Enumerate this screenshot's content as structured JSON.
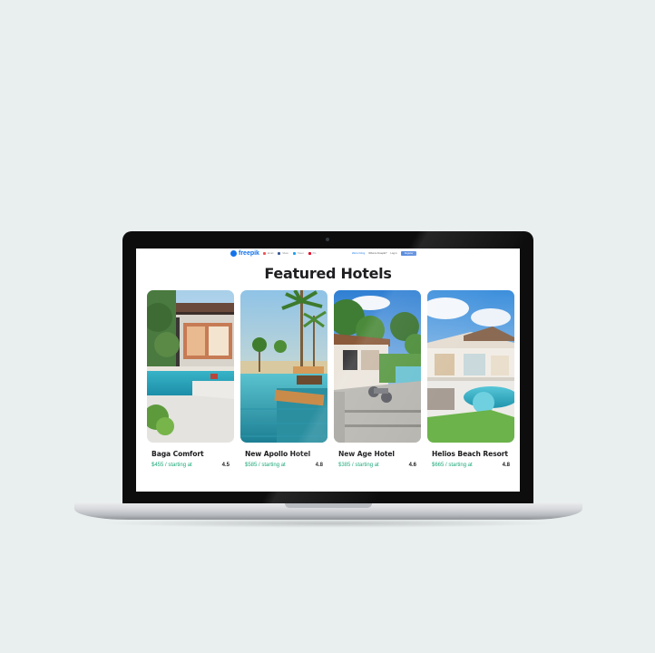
{
  "header": {
    "logo_text": "freepik",
    "social": [
      {
        "label": "Email",
        "color": "#e55",
        "icon": "email-icon"
      },
      {
        "label": "Share",
        "color": "#3b5998",
        "icon": "facebook-icon"
      },
      {
        "label": "Tweet",
        "color": "#1da1f2",
        "icon": "twitter-icon"
      },
      {
        "label": "Pin",
        "color": "#e60023",
        "icon": "pinterest-icon"
      }
    ],
    "nav": {
      "link1": "We're hiring",
      "link2": "What is Freepik?",
      "login": "Log in",
      "register": "Register"
    }
  },
  "page_title": "Featured Hotels",
  "hotels": [
    {
      "name": "Baga Comfort",
      "price": "$455 / starting at",
      "rating": "4.5"
    },
    {
      "name": "New Apollo Hotel",
      "price": "$585 / starting at",
      "rating": "4.8"
    },
    {
      "name": "New Age Hotel",
      "price": "$385 / starting at",
      "rating": "4.6"
    },
    {
      "name": "Helios Beach Resort",
      "price": "$665 / starting at",
      "rating": "4.8"
    }
  ],
  "colors": {
    "price_green": "#1ea97c",
    "brand_blue": "#1273eb",
    "register_bg": "#5c8ddf"
  }
}
